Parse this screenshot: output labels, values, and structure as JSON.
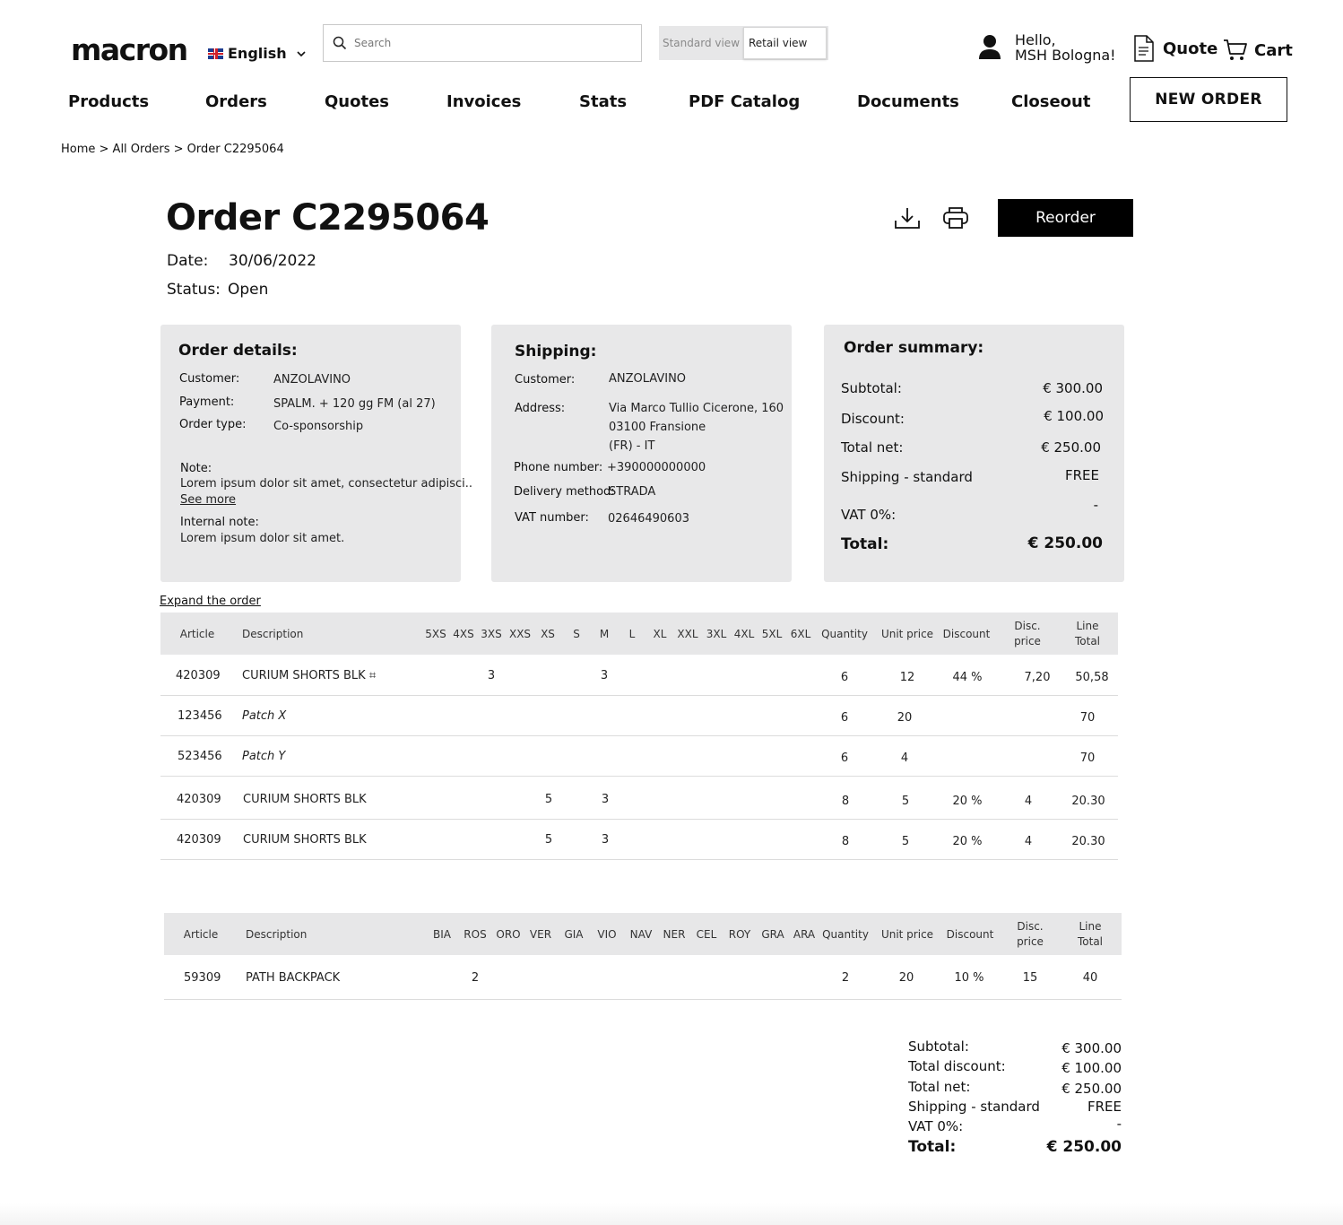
{
  "header": {
    "logo": "macron",
    "language": "English",
    "search_placeholder": "Search",
    "view_standard": "Standard view",
    "view_retail": "Retail view",
    "greeting_line1": "Hello,",
    "greeting_line2": "MSH Bologna!",
    "quote_label": "Quote",
    "cart_label": "Cart"
  },
  "nav": {
    "items": [
      "Products",
      "Orders",
      "Quotes",
      "Invoices",
      "Stats",
      "PDF Catalog",
      "Documents",
      "Closeout"
    ],
    "new_order": "NEW ORDER"
  },
  "breadcrumb": "Home > All Orders > Order C2295064",
  "order": {
    "title": "Order C2295064",
    "date_label": "Date:",
    "date": "30/06/2022",
    "status_label": "Status:",
    "status": "Open",
    "reorder": "Reorder"
  },
  "order_details": {
    "title": "Order details:",
    "customer_label": "Customer:",
    "customer": "ANZOLAVINO",
    "payment_label": "Payment:",
    "payment": "SPALM. + 120 gg FM (al 27)",
    "order_type_label": "Order type:",
    "order_type": "Co-sponsorship",
    "note_label": "Note:",
    "note": "Lorem ipsum dolor sit amet, consectetur adipisci..",
    "see_more": "See more",
    "internal_note_label": "Internal note:",
    "internal_note": "Lorem ipsum dolor sit amet."
  },
  "shipping": {
    "title": "Shipping:",
    "customer_label": "Customer:",
    "customer": "ANZOLAVINO",
    "address_label": "Address:",
    "address_line1": "Via Marco Tullio Cicerone, 160",
    "address_line2": "03100 Fransione",
    "address_line3": "(FR) - IT",
    "phone_label": "Phone number:",
    "phone": "+390000000000",
    "delivery_label": "Delivery method:",
    "delivery": "STRADA",
    "vat_label": "VAT number:",
    "vat": "02646490603"
  },
  "summary": {
    "title": "Order summary:",
    "subtotal_label": "Subtotal:",
    "subtotal": "€ 300.00",
    "discount_label": "Discount:",
    "discount": "€ 100.00",
    "total_net_label": "Total net:",
    "total_net": "€ 250.00",
    "shipping_label": "Shipping - standard",
    "shipping": "FREE",
    "vat_label": "VAT 0%:",
    "vat": "-",
    "total_label": "Total:",
    "total": "€ 250.00"
  },
  "expand_order": "Expand the order",
  "table1": {
    "headers": {
      "article": "Article",
      "description": "Description",
      "sizes": [
        "5XS",
        "4XS",
        "3XS",
        "XXS",
        "XS",
        "S",
        "M",
        "L",
        "XL",
        "XXL",
        "3XL",
        "4XL",
        "5XL",
        "6XL"
      ],
      "quantity": "Quantity",
      "unit_price": "Unit price",
      "discount": "Discount",
      "disc_price_1": "Disc.",
      "disc_price_2": "price",
      "line_total_1": "Line",
      "line_total_2": "Total"
    },
    "rows": [
      {
        "article": "420309",
        "description": "CURIUM SHORTS BLK ⌗",
        "italic": false,
        "qty_3xs": "3",
        "qty_xs": "",
        "qty_m": "3",
        "quantity": "6",
        "unit_price": "12",
        "discount": "44 %",
        "disc_price": "7,20",
        "line_total": "50,58"
      },
      {
        "article": "123456",
        "description": "Patch X",
        "italic": true,
        "qty_3xs": "",
        "qty_xs": "",
        "qty_m": "",
        "quantity": "6",
        "unit_price": "20",
        "discount": "",
        "disc_price": "",
        "line_total": "70"
      },
      {
        "article": "523456",
        "description": "Patch Y",
        "italic": true,
        "qty_3xs": "",
        "qty_xs": "",
        "qty_m": "",
        "quantity": "6",
        "unit_price": "4",
        "discount": "",
        "disc_price": "",
        "line_total": "70"
      },
      {
        "article": "420309",
        "description": "CURIUM SHORTS BLK",
        "italic": false,
        "qty_3xs": "",
        "qty_xs": "5",
        "qty_m": "3",
        "quantity": "8",
        "unit_price": "5",
        "discount": "20 %",
        "disc_price": "4",
        "line_total": "20.30"
      },
      {
        "article": "420309",
        "description": "CURIUM SHORTS BLK",
        "italic": false,
        "qty_3xs": "",
        "qty_xs": "5",
        "qty_m": "3",
        "quantity": "8",
        "unit_price": "5",
        "discount": "20 %",
        "disc_price": "4",
        "line_total": "20.30"
      }
    ]
  },
  "table2": {
    "headers": {
      "article": "Article",
      "description": "Description",
      "colors": [
        "BIA",
        "ROS",
        "ORO",
        "VER",
        "GIA",
        "VIO",
        "NAV",
        "NER",
        "CEL",
        "ROY",
        "GRA",
        "ARA"
      ],
      "quantity": "Quantity",
      "unit_price": "Unit price",
      "discount": "Discount",
      "disc_price_1": "Disc.",
      "disc_price_2": "price",
      "line_total_1": "Line",
      "line_total_2": "Total"
    },
    "rows": [
      {
        "article": "59309",
        "description": "PATH BACKPACK",
        "qty_ros": "2",
        "quantity": "2",
        "unit_price": "20",
        "discount": "10 %",
        "disc_price": "15",
        "line_total": "40"
      }
    ]
  },
  "totals": {
    "subtotal_label": "Subtotal:",
    "subtotal": "€ 300.00",
    "discount_label": "Total discount:",
    "discount": "€ 100.00",
    "total_net_label": "Total net:",
    "total_net": "€ 250.00",
    "shipping_label": "Shipping - standard",
    "shipping": "FREE",
    "vat_label": "VAT 0%:",
    "vat": "-",
    "total_label": "Total:",
    "total": "€ 250.00"
  },
  "icons": {
    "search": "search-icon",
    "user": "user-icon",
    "quote": "document-icon",
    "cart": "cart-icon",
    "download": "download-icon",
    "print": "print-icon",
    "chevron": "chevron-down-icon",
    "flag": "uk-flag-icon"
  }
}
